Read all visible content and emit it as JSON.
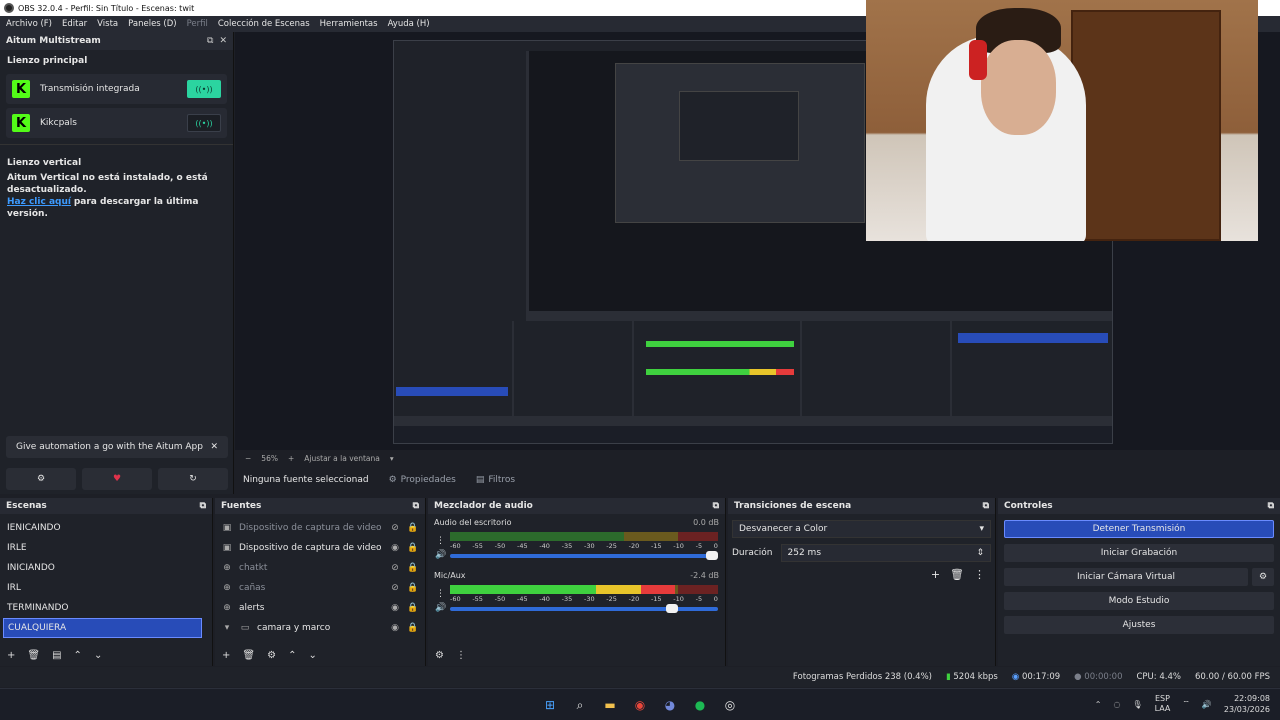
{
  "window": {
    "title": "OBS 32.0.4 - Perfil: Sin Título - Escenas: twit"
  },
  "menu": [
    "Archivo (F)",
    "Editar",
    "Vista",
    "Paneles (D)",
    "Perfil",
    "Colección de Escenas",
    "Herramientas",
    "Ayuda (H)"
  ],
  "aitum": {
    "title": "Aitum Multistream",
    "main_canvas_label": "Lienzo principal",
    "accounts": [
      {
        "name": "Transmisión integrada",
        "active": true
      },
      {
        "name": "Kikcpals",
        "active": false
      }
    ],
    "vertical_label": "Lienzo vertical",
    "vertical_msg": "Aitum Vertical no está instalado, o está desactualizado.",
    "vertical_link": "Haz clic aquí",
    "vertical_link_rest": "para descargar la última versión.",
    "automation_text": "Give automation a go with the Aitum App"
  },
  "preview": {
    "zoom": "56%",
    "fit_label": "Ajustar a la ventana"
  },
  "source_bar": {
    "no_source": "Ninguna fuente seleccionad",
    "properties": "Propiedades",
    "filters": "Filtros"
  },
  "scenes": {
    "title": "Escenas",
    "items": [
      "IENICAINDO",
      "IRLE",
      "INICIANDO",
      "IRL",
      "TERMINANDO",
      "CUALQUIERA"
    ],
    "selected": 5
  },
  "sources": {
    "title": "Fuentes",
    "items": [
      {
        "name": "Dispositivo de captura de video",
        "visible": false
      },
      {
        "name": "Dispositivo de captura de video",
        "visible": true
      },
      {
        "name": "chatkt",
        "visible": false
      },
      {
        "name": "cañas",
        "visible": false
      },
      {
        "name": "alerts",
        "visible": true
      },
      {
        "name": "camara y marco",
        "visible": true
      }
    ]
  },
  "mixer": {
    "title": "Mezclador de audio",
    "channels": [
      {
        "name": "Audio del escritorio",
        "db": "0.0 dB",
        "level": 0.0,
        "volume": 1.0
      },
      {
        "name": "Mic/Aux",
        "db": "-2.4 dB",
        "level": 0.84,
        "volume": 0.85
      }
    ],
    "ticks": [
      "-60",
      "-55",
      "-50",
      "-45",
      "-40",
      "-35",
      "-30",
      "-25",
      "-20",
      "-15",
      "-10",
      "-5",
      "0"
    ]
  },
  "transitions": {
    "title": "Transiciones de escena",
    "selected": "Desvanecer a Color",
    "duration_label": "Duración",
    "duration_value": "252 ms"
  },
  "controls": {
    "title": "Controles",
    "buttons": [
      "Detener Transmisión",
      "Iniciar Grabación",
      "Iniciar Cámara Virtual",
      "Modo Estudio",
      "Ajustes"
    ]
  },
  "status": {
    "dropped": "Fotogramas Perdidos 238 (0.4%)",
    "bitrate": "5204 kbps",
    "stream_time": "00:17:09",
    "rec_time": "00:00:00",
    "cpu": "CPU: 4.4%",
    "fps": "60.00 / 60.00 FPS"
  },
  "taskbar": {
    "lang": "ESP",
    "lang2": "LAA",
    "time": "22:09:08",
    "date": "23/03/2026"
  },
  "colors": {
    "accent": "#284cb8",
    "kick": "#53fc18",
    "stream_on": "#2bd4a0"
  }
}
